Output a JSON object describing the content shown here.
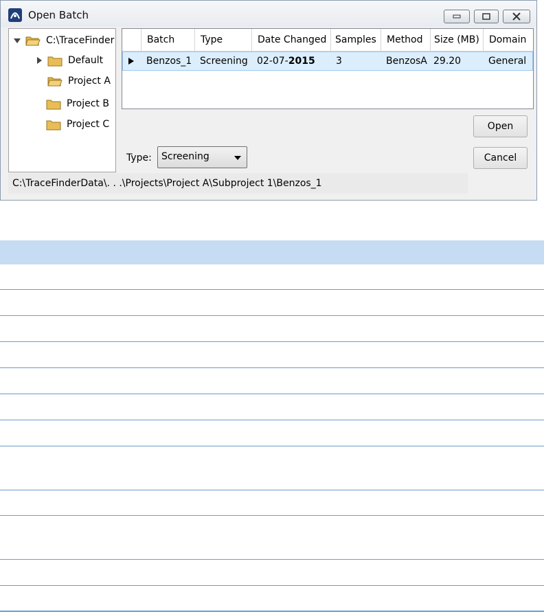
{
  "window": {
    "title": "Open Batch",
    "accent": "#1f3f78"
  },
  "tree": {
    "items": [
      {
        "label": "C:\\TraceFinder",
        "expanded": true
      },
      {
        "label": "Default",
        "expanded": false
      },
      {
        "label": "Project A"
      },
      {
        "label": "Project B"
      },
      {
        "label": "Project C"
      }
    ]
  },
  "grid": {
    "columns": [
      "Batch",
      "Type",
      "Date Changed",
      "Samples",
      "Method",
      "Size (MB)",
      "Domain"
    ],
    "rows": [
      {
        "batch": "Benzos_1",
        "type": "Screening",
        "date_prefix": "02-07-",
        "date_year": "2015",
        "samples": "3",
        "method": "BenzosA",
        "size": "29.20",
        "domain": "General"
      }
    ],
    "selected_row_color": "#dceefc"
  },
  "buttons": {
    "open_label": "Open",
    "cancel_label": "Cancel"
  },
  "type_filter": {
    "label": "Type:",
    "selected": "Screening"
  },
  "status": {
    "path": "C:\\TraceFinderData\\. . .\\Projects\\Project A\\Subproject 1\\Benzos_1"
  },
  "doc_table": {
    "header_color": "#c6dcf2",
    "rule_color": "#6b9bd1"
  }
}
